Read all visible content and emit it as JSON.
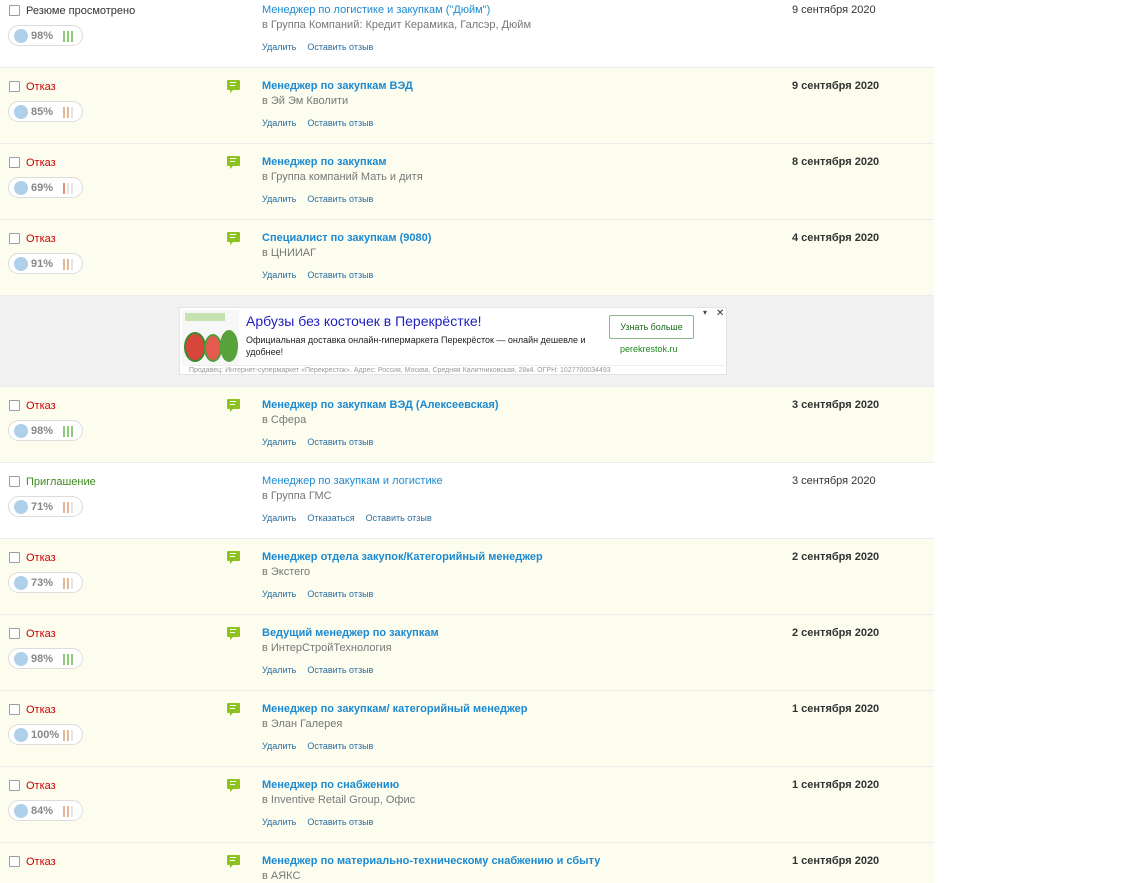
{
  "responses": [
    {
      "status": "Резюме просмотрено",
      "status_kind": "viewed",
      "match": "98%",
      "bars": [
        "#8dcb79",
        "#8dcb79",
        "#8dcb79"
      ],
      "chat": false,
      "title": "Менеджер по логистике и закупкам (\"Дюйм\")",
      "company": "в Группа Компаний: Кредит Керамика, Галсэр, Дюйм",
      "actions": [
        "Удалить",
        "Оставить отзыв"
      ],
      "date": "9 сентября 2020",
      "unread": false
    },
    {
      "status": "Отказ",
      "status_kind": "reject",
      "match": "85%",
      "bars": [
        "#e5b796",
        "#e5b796",
        "#e4e4e4"
      ],
      "chat": true,
      "title": "Менеджер по закупкам ВЭД",
      "company": "в Эй Эм Кволити",
      "actions": [
        "Удалить",
        "Оставить отзыв"
      ],
      "date": "9 сентября 2020",
      "unread": true
    },
    {
      "status": "Отказ",
      "status_kind": "reject",
      "match": "69%",
      "bars": [
        "#e58d7c",
        "#e4e4e4",
        "#e4e4e4"
      ],
      "chat": true,
      "title": "Менеджер по закупкам",
      "company": "в Группа компаний Мать и дитя",
      "actions": [
        "Удалить",
        "Оставить отзыв"
      ],
      "date": "8 сентября 2020",
      "unread": true
    },
    {
      "status": "Отказ",
      "status_kind": "reject",
      "match": "91%",
      "bars": [
        "#e5b796",
        "#e5b796",
        "#e4e4e4"
      ],
      "chat": true,
      "title": "Специалист по закупкам (9080)",
      "company": "в ЦНИИАГ",
      "actions": [
        "Удалить",
        "Оставить отзыв"
      ],
      "date": "4 сентября 2020",
      "unread": true
    }
  ],
  "ad": {
    "title": "Арбузы без косточек в Перекрёстке!",
    "text": "Официальная доставка онлайн-гипермаркета Перекрёсток — онлайн дешевле и удобнее!",
    "button": "Узнать больше",
    "domain": "perekrestok.ru",
    "legal": "Продавец: Интернет-супермаркет «Перекресток». Адрес: Россия, Москва, Средняя Калитниковская, 28к4. ОГРН: 1027700034493",
    "close": "✕",
    "info": "▾"
  },
  "responses2": [
    {
      "status": "Отказ",
      "status_kind": "reject",
      "match": "98%",
      "bars": [
        "#8dcb79",
        "#8dcb79",
        "#8dcb79"
      ],
      "chat": true,
      "title": "Менеджер по закупкам ВЭД (Алексеевская)",
      "company": "в Сфера",
      "actions": [
        "Удалить",
        "Оставить отзыв"
      ],
      "date": "3 сентября 2020",
      "unread": true
    },
    {
      "status": "Приглашение",
      "status_kind": "invite",
      "match": "71%",
      "bars": [
        "#e5b796",
        "#e5b796",
        "#e4e4e4"
      ],
      "chat": false,
      "title": "Менеджер по закупкам и логистике",
      "company": "в Группа ГМС",
      "actions": [
        "Удалить",
        "Отказаться",
        "Оставить отзыв"
      ],
      "date": "3 сентября 2020",
      "unread": false
    },
    {
      "status": "Отказ",
      "status_kind": "reject",
      "match": "73%",
      "bars": [
        "#e5b796",
        "#e5b796",
        "#e4e4e4"
      ],
      "chat": true,
      "title": "Менеджер отдела закупок/Категорийный менеджер",
      "company": "в Экстего",
      "actions": [
        "Удалить",
        "Оставить отзыв"
      ],
      "date": "2 сентября 2020",
      "unread": true
    },
    {
      "status": "Отказ",
      "status_kind": "reject",
      "match": "98%",
      "bars": [
        "#8dcb79",
        "#8dcb79",
        "#8dcb79"
      ],
      "chat": true,
      "title": "Ведущий менеджер по закупкам",
      "company": "в ИнтерСтройТехнология",
      "actions": [
        "Удалить",
        "Оставить отзыв"
      ],
      "date": "2 сентября 2020",
      "unread": true
    },
    {
      "status": "Отказ",
      "status_kind": "reject",
      "match": "100%",
      "bars": [
        "#e5b796",
        "#e5b796",
        "#e4e4e4"
      ],
      "chat": true,
      "title": "Менеджер по закупкам/ категорийный менеджер",
      "company": "в Элан Галерея",
      "actions": [
        "Удалить",
        "Оставить отзыв"
      ],
      "date": "1 сентября 2020",
      "unread": true
    },
    {
      "status": "Отказ",
      "status_kind": "reject",
      "match": "84%",
      "bars": [
        "#e5b796",
        "#e5b796",
        "#e4e4e4"
      ],
      "chat": true,
      "title": "Менеджер по снабжению",
      "company": "в Inventive Retail Group, Офис",
      "actions": [
        "Удалить",
        "Оставить отзыв"
      ],
      "date": "1 сентября 2020",
      "unread": true
    },
    {
      "status": "Отказ",
      "status_kind": "reject",
      "match": "",
      "bars": [],
      "chat": true,
      "title": "Менеджер по материально-техническому снабжению и сбыту",
      "company": "в АЯКС",
      "actions": [],
      "date": "1 сентября 2020",
      "unread": true
    }
  ]
}
